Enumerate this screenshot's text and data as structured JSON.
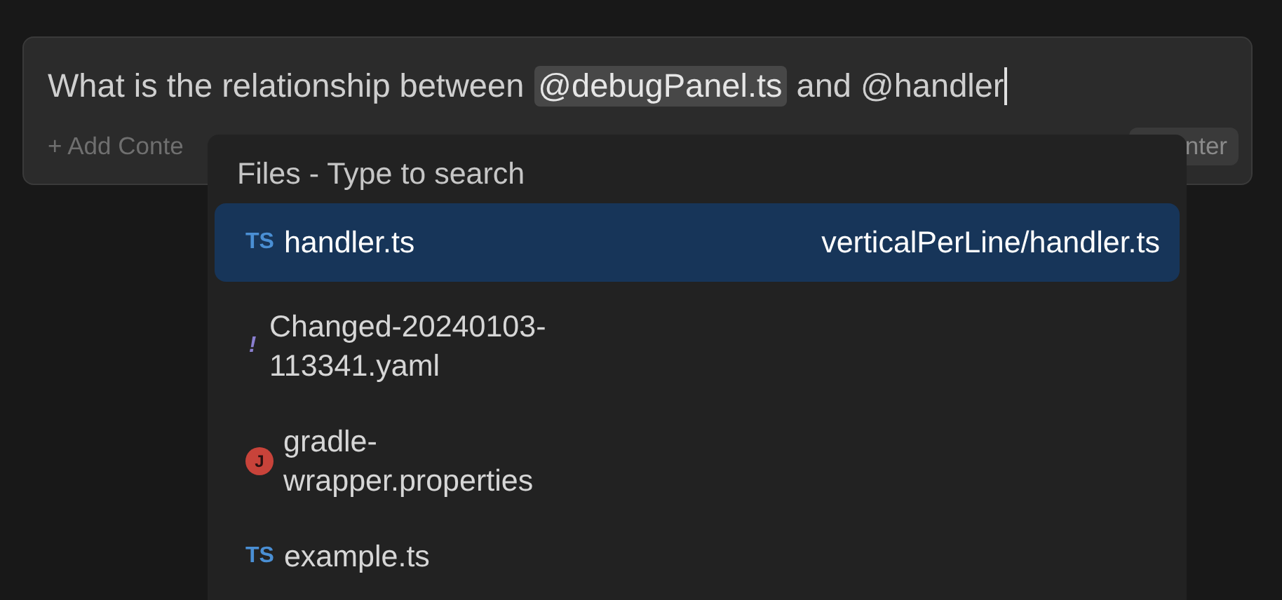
{
  "composer": {
    "segments": [
      {
        "kind": "text",
        "text": "What is the relationship between"
      },
      {
        "kind": "mention",
        "text": "@debugPanel.ts"
      },
      {
        "kind": "text",
        "text": "and @handler"
      }
    ],
    "add_context": "+ Add Conte",
    "submit_button": "nter"
  },
  "file_menu": {
    "title": "Files - Type to search",
    "items": [
      {
        "kind": "ts",
        "icon": "TS",
        "name": "handler.ts",
        "path": "verticalPerLine/handler.ts",
        "selected": true
      },
      {
        "kind": "yaml",
        "icon": "!",
        "name": "Changed-20240103-113341.yaml",
        "selected": false
      },
      {
        "kind": "java",
        "icon": "J",
        "name": "gradle-wrapper.properties",
        "selected": false
      },
      {
        "kind": "ts",
        "icon": "TS",
        "name": "example.ts",
        "selected": false
      }
    ]
  }
}
